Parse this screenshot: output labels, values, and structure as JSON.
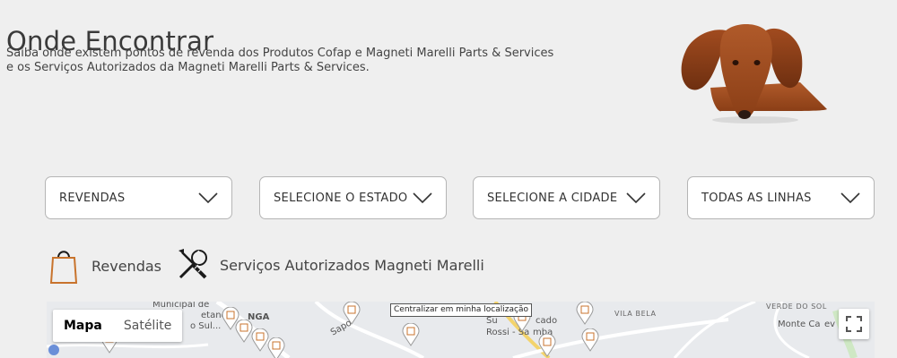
{
  "header": {
    "title": "Onde Encontrar",
    "subtitle_line1": "Saiba onde existem pontos de revenda dos Produtos Cofap e Magneti Marelli Parts & Services",
    "subtitle_line2": "e os Serviços Autorizados da Magneti Marelli Parts & Services."
  },
  "filters": [
    {
      "label": "REVENDAS",
      "icon": "chevron-down-icon"
    },
    {
      "label": "SELECIONE O ESTADO",
      "icon": "chevron-down-icon"
    },
    {
      "label": "SELECIONE A CIDADE",
      "icon": "chevron-down-icon"
    },
    {
      "label": "TODAS AS LINHAS",
      "icon": "chevron-down-icon"
    }
  ],
  "legend": {
    "revendas": {
      "label": "Revendas",
      "icon": "shopping-bag-icon"
    },
    "servicos": {
      "label": "Serviços Autorizados Magneti Marelli",
      "icon": "wrench-screwdriver-icon"
    }
  },
  "map": {
    "type_options": [
      "Mapa",
      "Satélite"
    ],
    "selected_type": "Mapa",
    "center_button": "Centralizar em minha localização",
    "fullscreen_icon": "fullscreen-icon",
    "labels": {
      "municipal": "Municipal de",
      "tiano": "etano",
      "sul": "o Sul...",
      "nga": "NGA",
      "vila_bela": "VILA BELA",
      "verde_do_sol": "VERDE DO SOL",
      "monte": "Monte Ca",
      "super": "Su",
      "cado": "cado",
      "rossi": "Rossi - Sa",
      "mba": "mba",
      "ev": "ev",
      "de": "DE",
      "sapo": "Sapo"
    }
  },
  "colors": {
    "background": "#efefef",
    "text": "#333333",
    "border": "#b5b5b5",
    "bag_orange": "#c8732c"
  }
}
